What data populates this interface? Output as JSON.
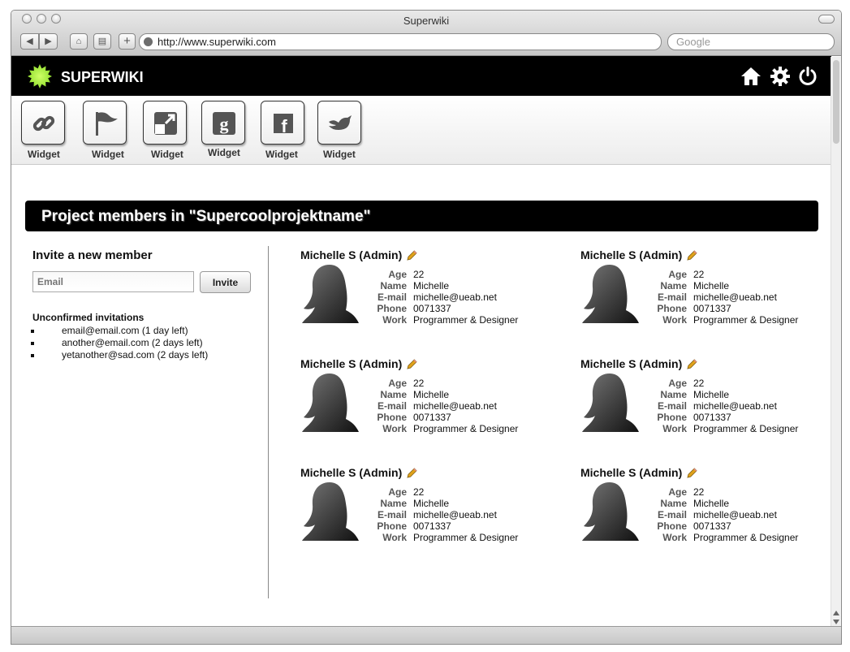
{
  "browser": {
    "title": "Superwiki",
    "url": "http://www.superwiki.com",
    "search_placeholder": "Google"
  },
  "app": {
    "logo_text": "SUPERWIKI",
    "icons": [
      "home-icon",
      "settings-icon",
      "power-icon"
    ]
  },
  "widgets": [
    {
      "label": "Widget",
      "icon": "link-icon"
    },
    {
      "label": "Widget",
      "icon": "flag-icon"
    },
    {
      "label": "Widget",
      "icon": "external-window-icon"
    },
    {
      "label": "Widget",
      "icon": "google-icon"
    },
    {
      "label": "Widget",
      "icon": "facebook-icon"
    },
    {
      "label": "Widget",
      "icon": "twitter-icon"
    }
  ],
  "page": {
    "header": "Project members in \"Supercoolprojektname\""
  },
  "invite": {
    "title": "Invite a new member",
    "email_placeholder": "Email",
    "button_label": "Invite",
    "unconfirmed_title": "Unconfirmed invitations",
    "items": [
      "email@email.com (1 day left)",
      "another@email.com (2 days left)",
      "yetanother@sad.com (2 days left)"
    ]
  },
  "member_labels": {
    "age": "Age",
    "name": "Name",
    "email": "E-mail",
    "phone": "Phone",
    "work": "Work"
  },
  "members": [
    {
      "title": "Michelle S (Admin)",
      "age": "22",
      "name": "Michelle",
      "email": "michelle@ueab.net",
      "phone": "0071337",
      "work": "Programmer & Designer"
    },
    {
      "title": "Michelle S (Admin)",
      "age": "22",
      "name": "Michelle",
      "email": "michelle@ueab.net",
      "phone": "0071337",
      "work": "Programmer & Designer"
    },
    {
      "title": "Michelle S (Admin)",
      "age": "22",
      "name": "Michelle",
      "email": "michelle@ueab.net",
      "phone": "0071337",
      "work": "Programmer & Designer"
    },
    {
      "title": "Michelle S (Admin)",
      "age": "22",
      "name": "Michelle",
      "email": "michelle@ueab.net",
      "phone": "0071337",
      "work": "Programmer & Designer"
    },
    {
      "title": "Michelle S (Admin)",
      "age": "22",
      "name": "Michelle",
      "email": "michelle@ueab.net",
      "phone": "0071337",
      "work": "Programmer & Designer"
    },
    {
      "title": "Michelle S (Admin)",
      "age": "22",
      "name": "Michelle",
      "email": "michelle@ueab.net",
      "phone": "0071337",
      "work": "Programmer & Designer"
    }
  ],
  "colors": {
    "header_bg": "#000000",
    "accent_green": "#7ad31a",
    "pencil": "#e0a21a"
  }
}
